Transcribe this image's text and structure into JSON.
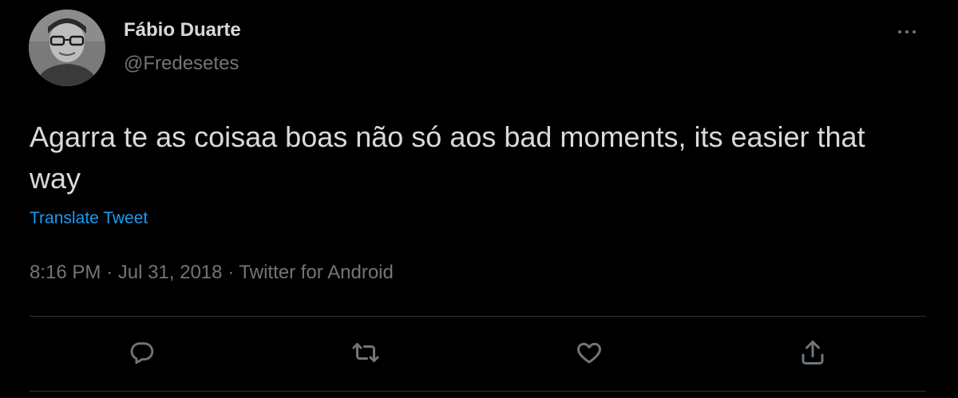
{
  "user": {
    "display_name": "Fábio Duarte",
    "handle": "@Fredesetes"
  },
  "tweet": {
    "text": "Agarra te as coisaa boas não só aos bad moments, its easier that way",
    "translate_label": "Translate Tweet",
    "time": "8:16 PM",
    "date": "Jul 31, 2018",
    "source": "Twitter for Android",
    "separator": "·"
  },
  "icons": {
    "more": "more-horizontal-icon",
    "reply": "reply-icon",
    "retweet": "retweet-icon",
    "like": "heart-icon",
    "share": "share-icon"
  },
  "colors": {
    "background": "#000000",
    "text_primary": "#d9d9d9",
    "text_secondary": "#6e767d",
    "link": "#1d9bf0",
    "divider": "#2f3336"
  }
}
